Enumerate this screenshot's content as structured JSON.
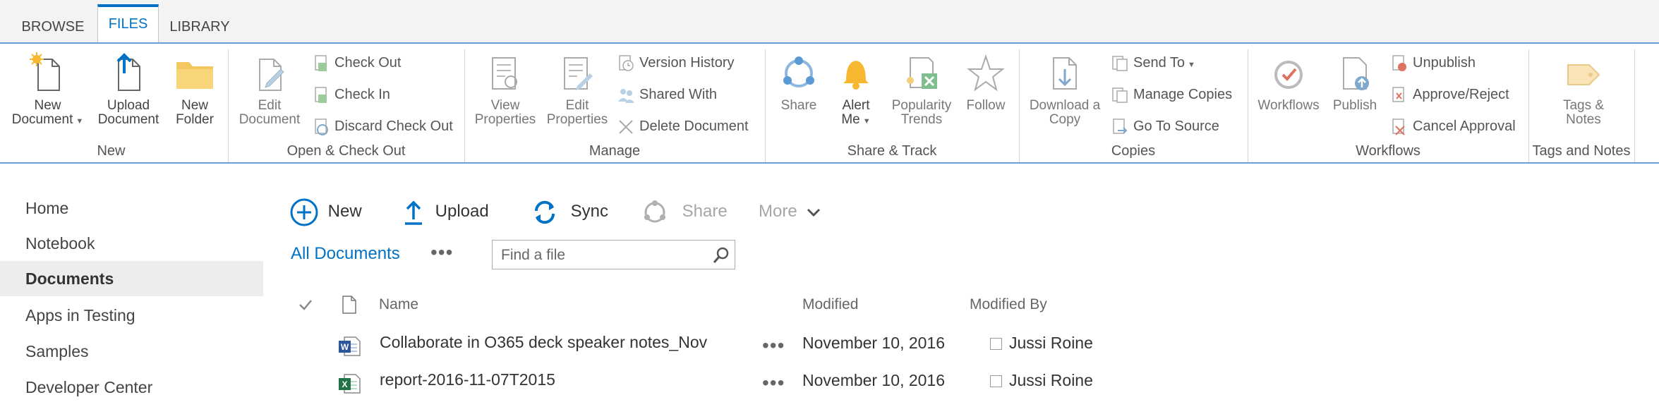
{
  "tabs": [
    {
      "label": "BROWSE"
    },
    {
      "label": "FILES"
    },
    {
      "label": "LIBRARY"
    }
  ],
  "ribbon": {
    "groups": {
      "new": "New",
      "open_checkout": "Open & Check Out",
      "manage": "Manage",
      "share_track": "Share & Track",
      "copies": "Copies",
      "workflows": "Workflows",
      "tags_notes": "Tags and Notes"
    },
    "new_document": {
      "line1": "New",
      "line2": "Document"
    },
    "upload_document": {
      "line1": "Upload",
      "line2": "Document"
    },
    "new_folder": {
      "line1": "New",
      "line2": "Folder"
    },
    "edit_document": {
      "line1": "Edit",
      "line2": "Document"
    },
    "check_out": "Check Out",
    "check_in": "Check In",
    "discard_check_out": "Discard Check Out",
    "view_properties": {
      "line1": "View",
      "line2": "Properties"
    },
    "edit_properties": {
      "line1": "Edit",
      "line2": "Properties"
    },
    "version_history": "Version History",
    "shared_with": "Shared With",
    "delete_document": "Delete Document",
    "share": "Share",
    "alert_me": {
      "line1": "Alert",
      "line2": "Me"
    },
    "popularity_trends": {
      "line1": "Popularity",
      "line2": "Trends"
    },
    "follow": "Follow",
    "download_copy": {
      "line1": "Download a",
      "line2": "Copy"
    },
    "send_to": "Send To",
    "manage_copies": "Manage Copies",
    "go_to_source": "Go To Source",
    "workflows": "Workflows",
    "publish": "Publish",
    "unpublish": "Unpublish",
    "approve_reject": "Approve/Reject",
    "cancel_approval": "Cancel Approval",
    "tags_notes": {
      "line1": "Tags &",
      "line2": "Notes"
    }
  },
  "nav": [
    {
      "label": "Home"
    },
    {
      "label": "Notebook"
    },
    {
      "label": "Documents"
    },
    {
      "label": "Apps in Testing"
    },
    {
      "label": "Samples"
    },
    {
      "label": "Developer Center"
    }
  ],
  "commands": {
    "new": "New",
    "upload": "Upload",
    "sync": "Sync",
    "share": "Share",
    "more": "More"
  },
  "view": {
    "current": "All Documents",
    "search_placeholder": "Find a file"
  },
  "list": {
    "columns": {
      "name": "Name",
      "modified": "Modified",
      "modified_by": "Modified By"
    },
    "rows": [
      {
        "name": "Collaborate in O365 deck speaker notes_Nov",
        "modified": "November 10, 2016",
        "modified_by": "Jussi Roine",
        "type": "word-icon"
      },
      {
        "name": "report-2016-11-07T2015",
        "modified": "November 10, 2016",
        "modified_by": "Jussi Roine",
        "type": "excel-icon"
      }
    ]
  },
  "colors": {
    "accent": "#0072c6",
    "ribbon_border": "#6b9ed3",
    "selected_nav": "#ededed"
  }
}
